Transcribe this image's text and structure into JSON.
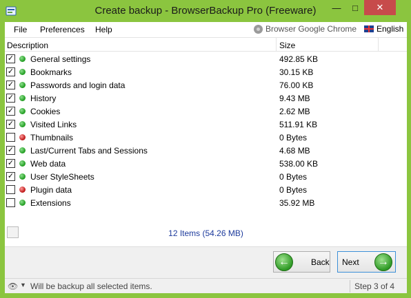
{
  "window": {
    "title": "Create backup - BrowserBackup Pro (Freeware)",
    "minimize_glyph": "—",
    "maximize_glyph": "□",
    "close_glyph": "✕",
    "accent_color": "#8bc53f"
  },
  "menu": {
    "file": "File",
    "preferences": "Preferences",
    "help": "Help",
    "browser": "Browser Google Chrome",
    "language": "English"
  },
  "list": {
    "columns": {
      "description": "Description",
      "size": "Size"
    },
    "rows": [
      {
        "checked": true,
        "status": "green",
        "label": "General settings",
        "size": "492.85 KB"
      },
      {
        "checked": true,
        "status": "green",
        "label": "Bookmarks",
        "size": "30.15 KB"
      },
      {
        "checked": true,
        "status": "green",
        "label": "Passwords and login data",
        "size": "76.00 KB"
      },
      {
        "checked": true,
        "status": "green",
        "label": "History",
        "size": "9.43 MB"
      },
      {
        "checked": true,
        "status": "green",
        "label": "Cookies",
        "size": "2.62 MB"
      },
      {
        "checked": true,
        "status": "green",
        "label": "Visited Links",
        "size": "511.91 KB"
      },
      {
        "checked": false,
        "status": "red",
        "label": "Thumbnails",
        "size": "0 Bytes"
      },
      {
        "checked": true,
        "status": "green",
        "label": "Last/Current Tabs and Sessions",
        "size": "4.68 MB"
      },
      {
        "checked": true,
        "status": "green",
        "label": "Web data",
        "size": "538.00 KB"
      },
      {
        "checked": true,
        "status": "green",
        "label": "User StyleSheets",
        "size": "0 Bytes"
      },
      {
        "checked": false,
        "status": "red",
        "label": "Plugin data",
        "size": "0 Bytes"
      },
      {
        "checked": false,
        "status": "green",
        "label": "Extensions",
        "size": "35.92 MB"
      }
    ],
    "summary": "12 Items (54.26 MB)"
  },
  "wizard": {
    "back_label": "Back",
    "next_label": "Next"
  },
  "footer": {
    "message": "Will be backup all selected items.",
    "step": "Step 3 of 4"
  }
}
